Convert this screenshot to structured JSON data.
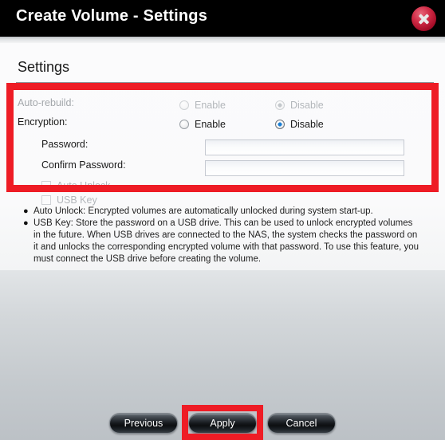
{
  "window": {
    "title": "Create Volume - Settings",
    "close_icon": "close-icon"
  },
  "section": {
    "heading": "Settings"
  },
  "form": {
    "rows": [
      {
        "label": "Auto-rebuild:",
        "disabled": true,
        "options": [
          {
            "label": "Enable",
            "selected": false
          },
          {
            "label": "Disable",
            "selected": true
          }
        ]
      },
      {
        "label": "Encryption:",
        "disabled": false,
        "options": [
          {
            "label": "Enable",
            "selected": false
          },
          {
            "label": "Disable",
            "selected": true
          }
        ]
      }
    ],
    "password": {
      "label": "Password:",
      "value": "",
      "placeholder": ""
    },
    "confirm_password": {
      "label": "Confirm Password:",
      "value": "",
      "placeholder": ""
    },
    "checkboxes": [
      {
        "label": "Auto Unlock",
        "checked": false,
        "disabled": true
      },
      {
        "label": "USB Key",
        "checked": false,
        "disabled": true
      }
    ]
  },
  "help": {
    "items": [
      "Auto Unlock: Encrypted volumes are automatically unlocked during system start-up.",
      "USB Key: Store the password on a USB drive. This can be used to unlock encrypted volumes in the future. When USB drives are connected to the NAS, the system checks the password on it and unlocks the corresponding encrypted volume with that password. To use this feature, you must connect the USB drive before creating the volume."
    ],
    "bullet": "●"
  },
  "footer": {
    "previous_label": "Previous",
    "apply_label": "Apply",
    "cancel_label": "Cancel"
  },
  "annotations": {
    "color": "#ee1c25",
    "settings_box": "settings-region-highlight",
    "apply_box": "apply-button-highlight"
  }
}
